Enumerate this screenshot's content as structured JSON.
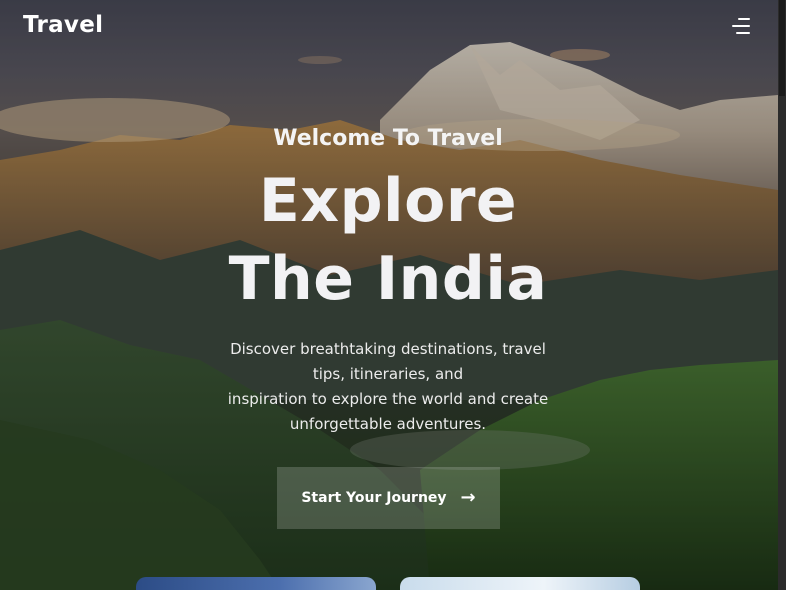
{
  "header": {
    "brand": "Travel",
    "menu_icon": "hamburger-menu-icon"
  },
  "hero": {
    "welcome": "Welcome To Travel",
    "headline_line1": "Explore",
    "headline_line2": "The India",
    "description_lines": [
      "Discover breathtaking destinations, travel",
      "tips, itineraries, and",
      "inspiration to explore the world and create",
      "unforgettable adventures."
    ],
    "cta_label": "Start Your Journey",
    "cta_icon": "arrow-right-icon"
  },
  "colors": {
    "text": "#ffffff",
    "button_bg": "rgba(255,255,255,0.18)"
  }
}
